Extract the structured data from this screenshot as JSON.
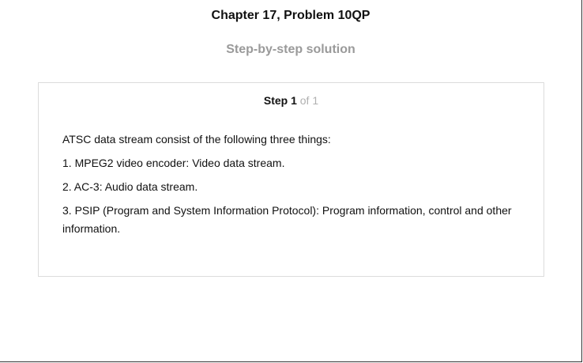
{
  "header": {
    "chapter_title": "Chapter 17, Problem 10QP",
    "subtitle": "Step-by-step solution"
  },
  "step": {
    "label": "Step 1",
    "of_text": "of 1"
  },
  "solution": {
    "paragraphs": [
      "ATSC data stream consist of the following three things:",
      "1. MPEG2 video encoder: Video data stream.",
      "2. AC-3: Audio data stream.",
      "3. PSIP (Program and System Information Protocol): Program information, control and other information."
    ]
  },
  "colors": {
    "subtitle": "#9a9a9a",
    "step_of": "#b0b0b0",
    "card_border": "#dcdcdc"
  }
}
